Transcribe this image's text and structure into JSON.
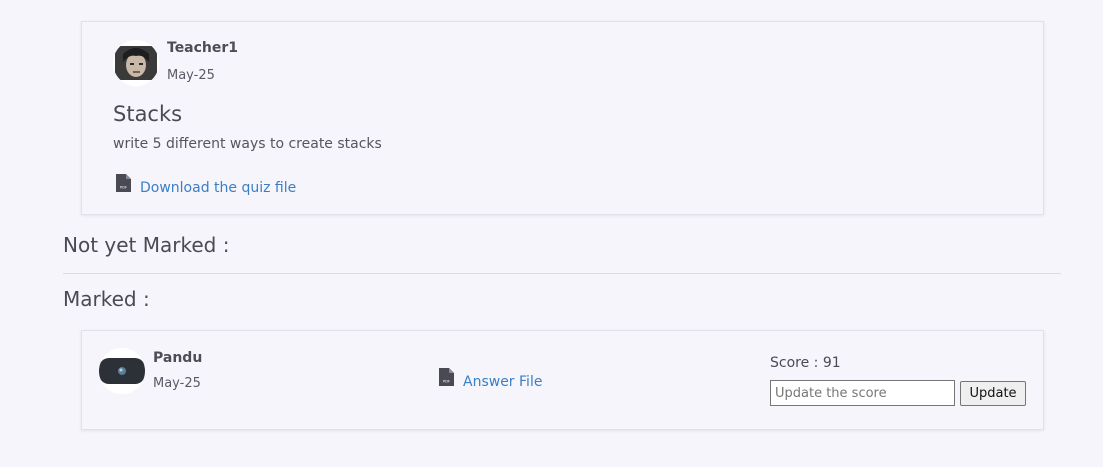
{
  "quiz": {
    "author": "Teacher1",
    "date": "May-25",
    "title": "Stacks",
    "description": "write 5 different ways to create stacks",
    "download_label": "Download the quiz file"
  },
  "sections": {
    "not_marked_heading": "Not yet Marked :",
    "marked_heading": "Marked :"
  },
  "submission": {
    "student_name": "Pandu",
    "date": "May-25",
    "answer_file_label": "Answer File",
    "score_label": "Score : 91",
    "score_placeholder": "Update the score",
    "update_button_label": "Update"
  },
  "icons": {
    "file": "pdf-file-icon"
  },
  "colors": {
    "link": "#3a7fc6",
    "background": "#f6f5fb"
  }
}
